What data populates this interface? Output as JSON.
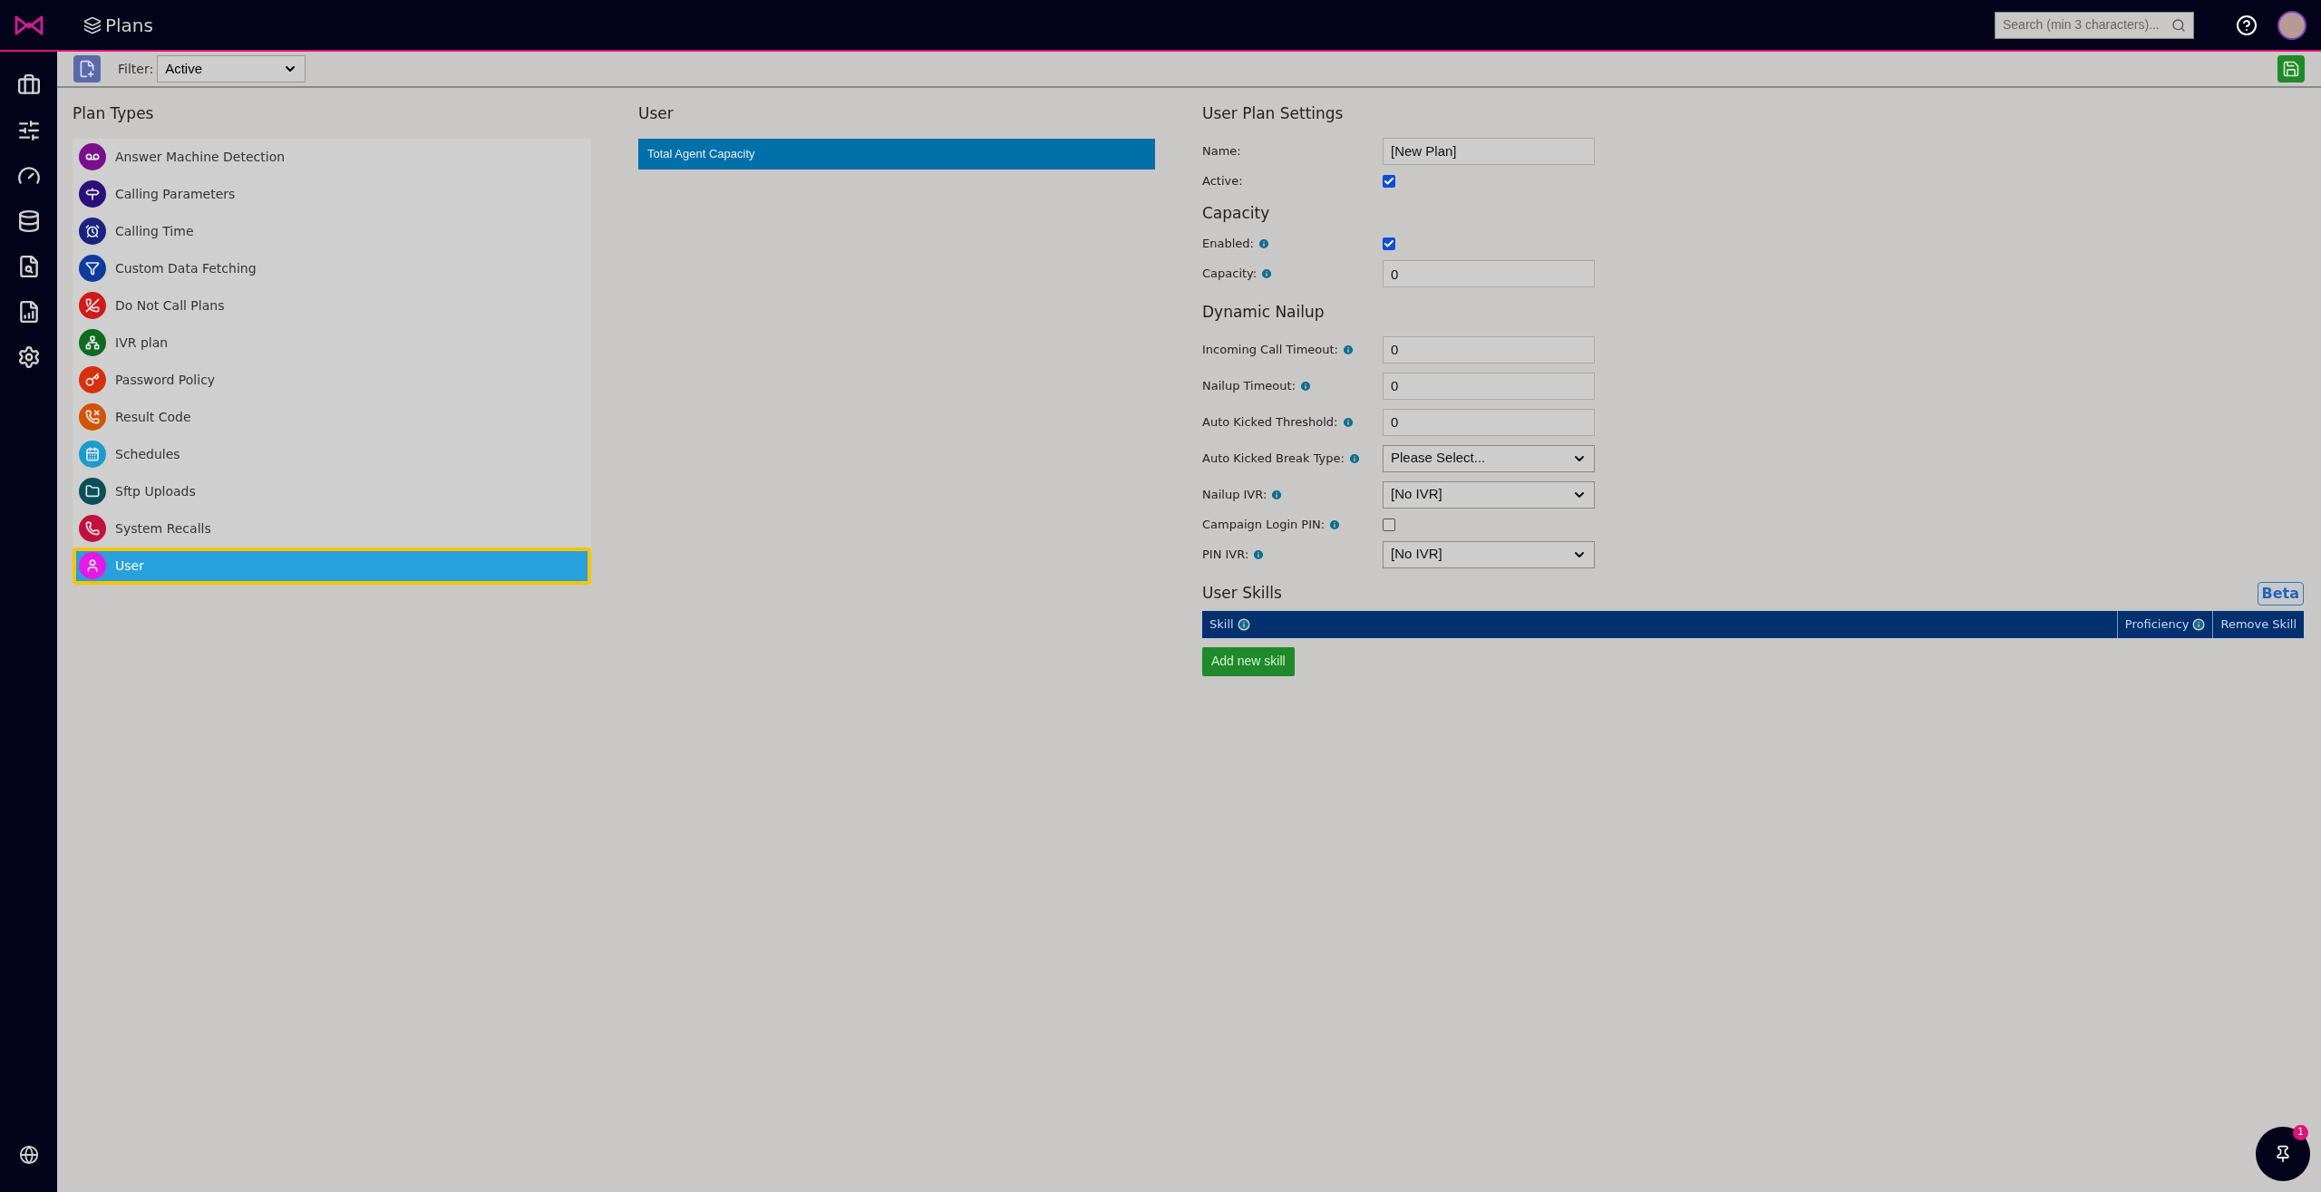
{
  "header": {
    "title": "Plans",
    "search": {
      "placeholder": "Search (min 3 characters)..."
    }
  },
  "toolbar": {
    "filter_label": "Filter:",
    "filter_value": "Active"
  },
  "plan_types": {
    "title": "Plan Types",
    "items": [
      {
        "label": "Answer Machine Detection",
        "color": "#7a0f8c",
        "selected": false
      },
      {
        "label": "Calling Parameters",
        "color": "#2b0f7a",
        "selected": false
      },
      {
        "label": "Calling Time",
        "color": "#1a237e",
        "selected": false
      },
      {
        "label": "Custom Data Fetching",
        "color": "#0d3c9c",
        "selected": false
      },
      {
        "label": "Do Not Call Plans",
        "color": "#d11a1a",
        "selected": false
      },
      {
        "label": "IVR plan",
        "color": "#0f6b1f",
        "selected": false
      },
      {
        "label": "Password Policy",
        "color": "#d6300f",
        "selected": false
      },
      {
        "label": "Result Code",
        "color": "#d35400",
        "selected": false
      },
      {
        "label": "Schedules",
        "color": "#1a9ccc",
        "selected": false
      },
      {
        "label": "Sftp Uploads",
        "color": "#0b4f5a",
        "selected": false
      },
      {
        "label": "System Recalls",
        "color": "#c2103c",
        "selected": false
      },
      {
        "label": "User",
        "color": "#e51ae5",
        "selected": true
      }
    ]
  },
  "plans": {
    "title": "User",
    "items": [
      {
        "label": "Total Agent Capacity",
        "selected": true
      }
    ]
  },
  "settings": {
    "sections": [
      {
        "heading": "User Plan Settings",
        "fields": [
          {
            "label": "Name:",
            "kind": "text",
            "value": "[New Plan]",
            "info": false
          },
          {
            "label": "Active:",
            "kind": "checkbox",
            "checked": true,
            "info": false
          }
        ]
      },
      {
        "heading": "Capacity",
        "fields": [
          {
            "label": "Enabled:",
            "kind": "checkbox",
            "checked": true,
            "info": true
          },
          {
            "label": "Capacity:",
            "kind": "text",
            "value": "0",
            "info": true
          }
        ]
      },
      {
        "heading": "Dynamic Nailup",
        "fields": [
          {
            "label": "Incoming Call Timeout:",
            "kind": "text",
            "value": "0",
            "info": true
          },
          {
            "label": "Nailup Timeout:",
            "kind": "text",
            "value": "0",
            "info": true
          },
          {
            "label": "Auto Kicked Threshold:",
            "kind": "text",
            "value": "0",
            "info": true
          },
          {
            "label": "Auto Kicked Break Type:",
            "kind": "select",
            "value": "Please Select...",
            "info": true
          },
          {
            "label": "Nailup IVR:",
            "kind": "select",
            "value": "[No IVR]",
            "info": true
          },
          {
            "label": "Campaign Login PIN:",
            "kind": "checkbox",
            "checked": false,
            "info": true
          },
          {
            "label": "PIN IVR:",
            "kind": "select",
            "value": "[No IVR]",
            "info": true
          }
        ]
      }
    ]
  },
  "skills": {
    "title": "User Skills",
    "badge": "Beta",
    "columns": [
      {
        "label": "Skill",
        "info": true
      },
      {
        "label": "Proficiency",
        "info": true
      },
      {
        "label": "Remove Skill",
        "info": false
      }
    ],
    "add_button": "Add new skill"
  },
  "notifications": {
    "count": "1"
  }
}
